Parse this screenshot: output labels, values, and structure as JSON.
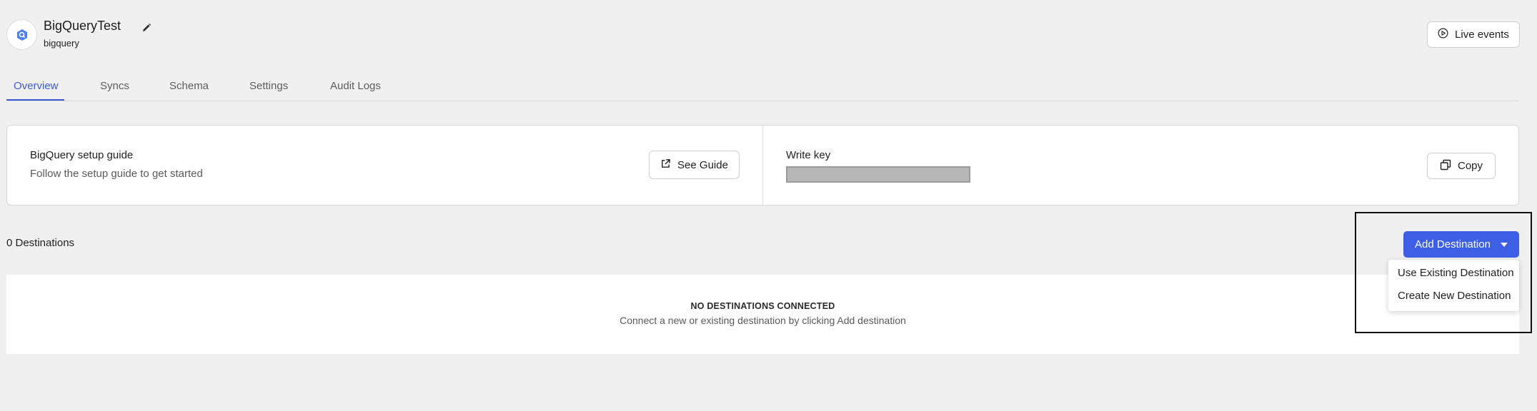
{
  "header": {
    "title": "BigQueryTest",
    "subtitle": "bigquery",
    "logo_icon": "bigquery-logo-icon",
    "edit_icon": "pencil-icon",
    "live_events_label": "Live events",
    "live_events_icon": "play-circle-icon"
  },
  "tabs": [
    {
      "label": "Overview",
      "active": true
    },
    {
      "label": "Syncs",
      "active": false
    },
    {
      "label": "Schema",
      "active": false
    },
    {
      "label": "Settings",
      "active": false
    },
    {
      "label": "Audit Logs",
      "active": false
    }
  ],
  "setup": {
    "title": "BigQuery setup guide",
    "description": "Follow the setup guide to get started",
    "button_label": "See Guide",
    "button_icon": "external-link-icon"
  },
  "write_key": {
    "label": "Write key",
    "copy_label": "Copy",
    "copy_icon": "copy-icon"
  },
  "destinations": {
    "count_label": "0 Destinations",
    "add_button_label": "Add Destination",
    "menu_items": [
      "Use Existing Destination",
      "Create New Destination"
    ],
    "empty_title": "NO DESTINATIONS CONNECTED",
    "empty_description": "Connect a new or existing destination by clicking Add destination"
  },
  "colors": {
    "accent": "#3d5fe6",
    "active_tab": "#3d5bd8",
    "background": "#f0f0f0"
  }
}
